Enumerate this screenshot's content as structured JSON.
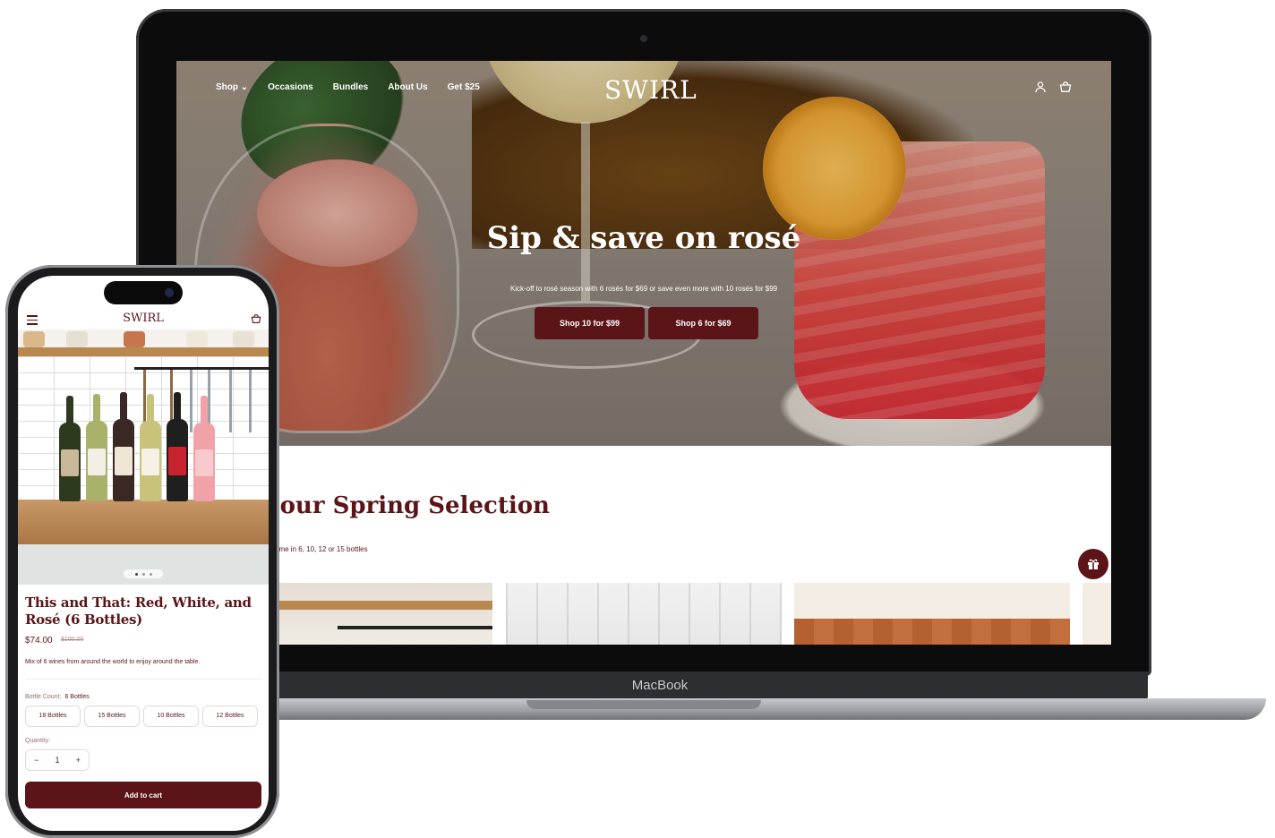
{
  "brand": {
    "logo": "SWIRL",
    "accent": "#5b1418"
  },
  "desktop": {
    "nav": {
      "links": [
        "Shop ⌄",
        "Occasions",
        "Bundles",
        "About Us",
        "Get $25"
      ],
      "icons": [
        "account-icon",
        "cart-icon"
      ]
    },
    "hero": {
      "title": "Sip & save on rosé",
      "subtitle": "Kick-off to rosé season with 6 rosés for $69 or save even more with 10 rosés for $99",
      "buttons": [
        "Shop 10 for $99",
        "Shop 6 for $69"
      ]
    },
    "section": {
      "title": "e our Spring Selection",
      "subtitle": "ome in 6, 10, 12 or 15 bottles"
    },
    "gift_icon": "gift-icon",
    "laptop_label": "MacBook"
  },
  "mobile": {
    "logo": "SWIRL",
    "icons": [
      "menu-icon",
      "cart-icon"
    ],
    "product": {
      "title": "This and That: Red, White, and Rosé (6 Bottles)",
      "price": "$74.00",
      "compare_price": "$100.00",
      "description": "Mix of 6 wines from around the world to enjoy around the table.",
      "bottle_count_label": "Bottle Count:",
      "bottle_count_value": "6 Bottles",
      "options": [
        "18 Bottles",
        "15 Bottles",
        "10 Bottles",
        "12 Bottles"
      ],
      "quantity_label": "Quantity:",
      "quantity_minus": "−",
      "quantity": "1",
      "quantity_plus": "+",
      "add_to_cart": "Add to cart"
    },
    "carousel": {
      "slides": 3,
      "active": 1
    }
  }
}
